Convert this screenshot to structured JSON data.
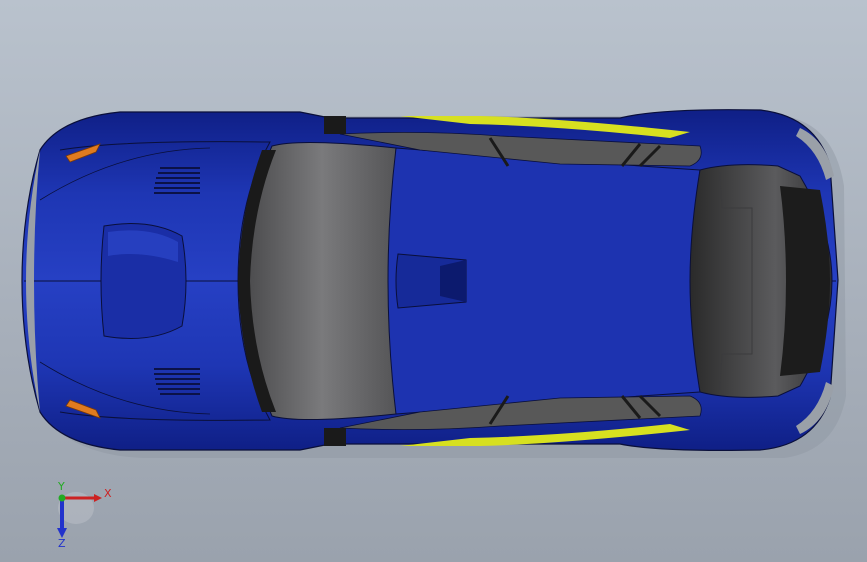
{
  "viewport": {
    "background_top": "#b9c2cd",
    "background_bottom": "#9aa2ad"
  },
  "model": {
    "body_color": "#1a2fa8",
    "body_shadow": "#0d1a6e",
    "glass_color": "#6d6d6f",
    "stripe_color": "#d7e020",
    "light_color": "#e07b1f"
  },
  "triad": {
    "x_label": "X",
    "y_label": "Y",
    "z_label": "Z",
    "x_color": "#cc2222",
    "y_color": "#22aa22",
    "z_color": "#2233cc"
  }
}
